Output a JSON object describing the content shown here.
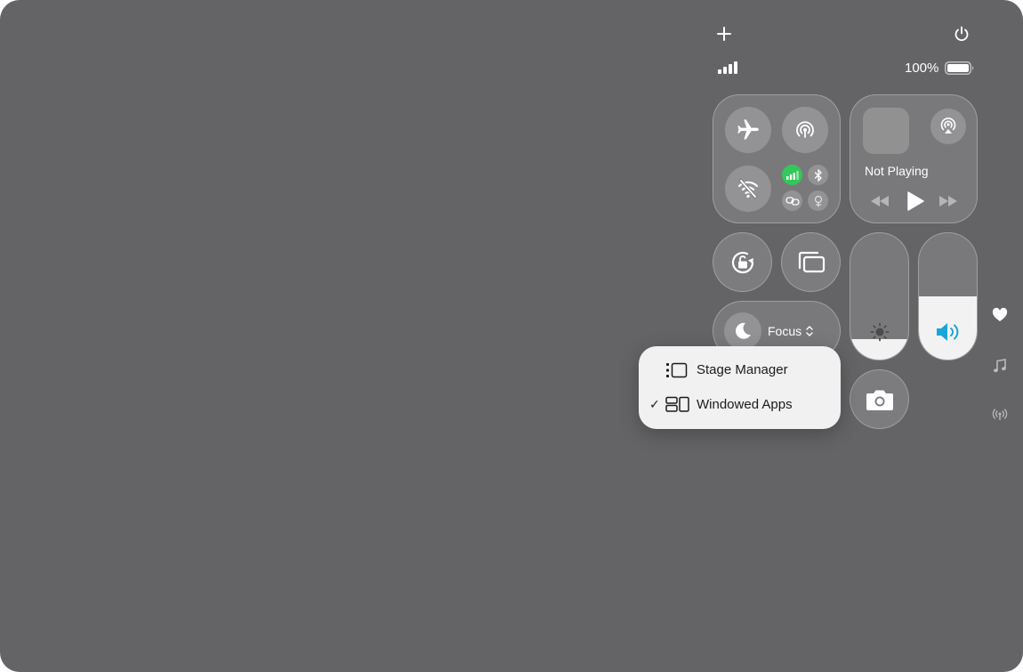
{
  "status": {
    "battery_percent_text": "100%",
    "battery_level": 1.0
  },
  "media": {
    "now_playing_text": "Not Playing"
  },
  "focus": {
    "label": "Focus"
  },
  "sliders": {
    "brightness_level": 0.16,
    "volume_level": 0.5
  },
  "colors": {
    "cellular_active": "#34c759",
    "volume_accent": "#1aa5d9"
  },
  "menu": {
    "items": [
      {
        "label": "Stage Manager",
        "checked": false
      },
      {
        "label": "Windowed Apps",
        "checked": true
      }
    ],
    "checkmark": "✓"
  },
  "icons": {
    "add": "plus-icon",
    "power": "power-icon",
    "signal": "signal-bars-icon",
    "battery": "battery-icon",
    "airplane": "airplane-icon",
    "airdrop": "airdrop-icon",
    "wifi_off": "wifi-off-icon",
    "cellular": "cellular-icon",
    "bluetooth": "bluetooth-icon",
    "personal_hotspot": "link-icon",
    "vpn": "vpn-icon",
    "airplay": "airplay-icon",
    "rewind": "rewind-icon",
    "play": "play-icon",
    "fast_forward": "fast-forward-icon",
    "rotation_lock": "rotation-lock-icon",
    "screen_mirroring": "screen-mirroring-icon",
    "moon": "moon-icon",
    "brightness": "sun-icon",
    "volume": "speaker-icon",
    "camera": "camera-icon",
    "heart": "heart-icon",
    "music": "music-note-icon",
    "radio": "radio-waves-icon",
    "stage_manager": "stage-manager-icon",
    "windowed_apps": "windowed-apps-icon"
  }
}
